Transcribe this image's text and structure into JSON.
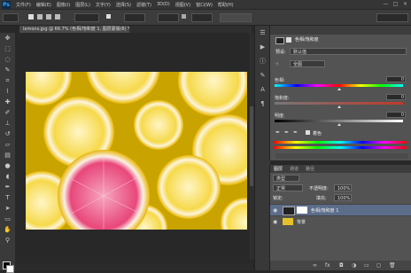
{
  "app": {
    "logo": "Ps"
  },
  "menu": {
    "items": [
      "文件(F)",
      "编辑(E)",
      "图像(I)",
      "图层(L)",
      "文字(Y)",
      "选择(S)",
      "滤镜(T)",
      "3D(D)",
      "视图(V)",
      "窗口(W)",
      "帮助(H)"
    ]
  },
  "window_controls": {
    "minimize": "—",
    "maximize": "□",
    "close": "×"
  },
  "options_bar": {
    "mode_value": "像素",
    "icons": [
      "rect-select-icon",
      "mode-icon"
    ]
  },
  "document": {
    "tab_label": "lemons.jpg @ 66.7% (色相/饱和度 1, 图层蒙版/8) *"
  },
  "properties": {
    "title": "色相/饱和度",
    "preset_label": "预设:",
    "preset_value": "默认值",
    "channel_value": "全图",
    "hue_label": "色相:",
    "hue_value": "0",
    "saturation_label": "饱和度:",
    "saturation_value": "0",
    "lightness_label": "明度:",
    "lightness_value": "0",
    "colorize_label": "着色",
    "hue_fraction": 0.5,
    "saturation_fraction": 0.5,
    "lightness_fraction": 0.5
  },
  "layers": {
    "tabs": [
      "图层",
      "通道",
      "路径"
    ],
    "kind_filter": "类型",
    "blend_mode": "正常",
    "opacity_label": "不透明度:",
    "opacity_value": "100%",
    "lock_label": "锁定:",
    "fill_label": "填充:",
    "fill_value": "100%",
    "rows": [
      {
        "name": "色相/饱和度 1",
        "selected": true
      },
      {
        "name": "背景",
        "selected": false
      }
    ],
    "footer_icons": [
      "link-icon",
      "fx-icon",
      "mask-icon",
      "adjustment-icon",
      "group-icon",
      "new-layer-icon",
      "trash-icon"
    ]
  },
  "colors": {
    "accent": "#31a8ff",
    "panel": "#535353",
    "selected_layer": "#5c6d8a",
    "lemon": "#f3d33a",
    "grapefruit": "#e8477a"
  }
}
